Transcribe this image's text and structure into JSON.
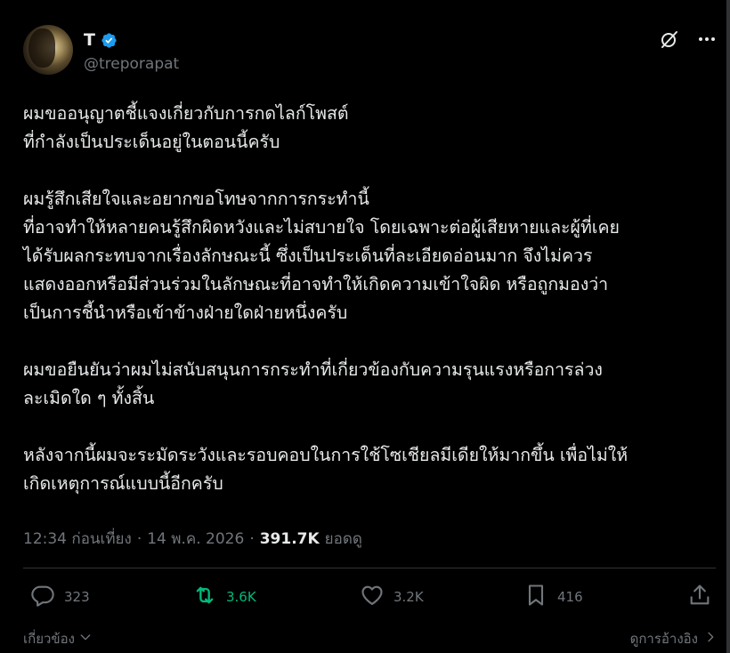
{
  "post": {
    "author": {
      "display_name": "T",
      "handle": "@treporapat",
      "verified": true
    },
    "paragraphs": [
      "ผมขออนุญาตชี้แจงเกี่ยวกับการกดไลก์โพสต์\nที่กำลังเป็นประเด็นอยู่ในตอนนี้ครับ",
      "ผมรู้สึกเสียใจและอยากขอโทษจากการกระทำนี้\nที่อาจทำให้หลายคนรู้สึกผิดหวังและไม่สบายใจ โดยเฉพาะต่อผู้เสียหายและผู้ที่เคย\nได้รับผลกระทบจากเรื่องลักษณะนี้ ซึ่งเป็นประเด็นที่ละเอียดอ่อนมาก จึงไม่ควร\nแสดงออกหรือมีส่วนร่วมในลักษณะที่อาจทำให้เกิดความเข้าใจผิด หรือถูกมองว่า\nเป็นการชี้นำหรือเข้าข้างฝ่ายใดฝ่ายหนึ่งครับ",
      "ผมขอยืนยันว่าผมไม่สนับสนุนการกระทำที่เกี่ยวข้องกับความรุนแรงหรือการล่วง\nละเมิดใด ๆ ทั้งสิ้น",
      "หลังจากนี้ผมจะระมัดระวังและรอบคอบในการใช้โซเชียลมีเดียให้มากขึ้น เพื่อไม่ให้\nเกิดเหตุการณ์แบบนี้อีกครับ"
    ],
    "meta": {
      "time": "12:34 ก่อนเที่ยง",
      "separator": "·",
      "date": "14 พ.ค. 2026",
      "views_count": "391.7K",
      "views_label": "ยอดดู"
    },
    "actions": {
      "replies": "323",
      "reposts": "3.6K",
      "likes": "3.2K",
      "bookmarks": "416"
    },
    "footer": {
      "related_label": "เกี่ยวข้อง",
      "quotes_label": "ดูการอ้างอิง"
    }
  },
  "colors": {
    "background": "#000000",
    "text": "#e7e9ea",
    "muted": "#71767b",
    "verified_blue": "#1d9bf0",
    "repost_green": "#00ba7c",
    "divider": "#2f3336"
  },
  "icons": {
    "verified": "verified-badge-icon",
    "grok": "grok-icon",
    "more": "more-icon",
    "reply": "reply-icon",
    "repost": "repost-icon",
    "like": "like-icon",
    "bookmark": "bookmark-icon",
    "share": "share-icon"
  }
}
